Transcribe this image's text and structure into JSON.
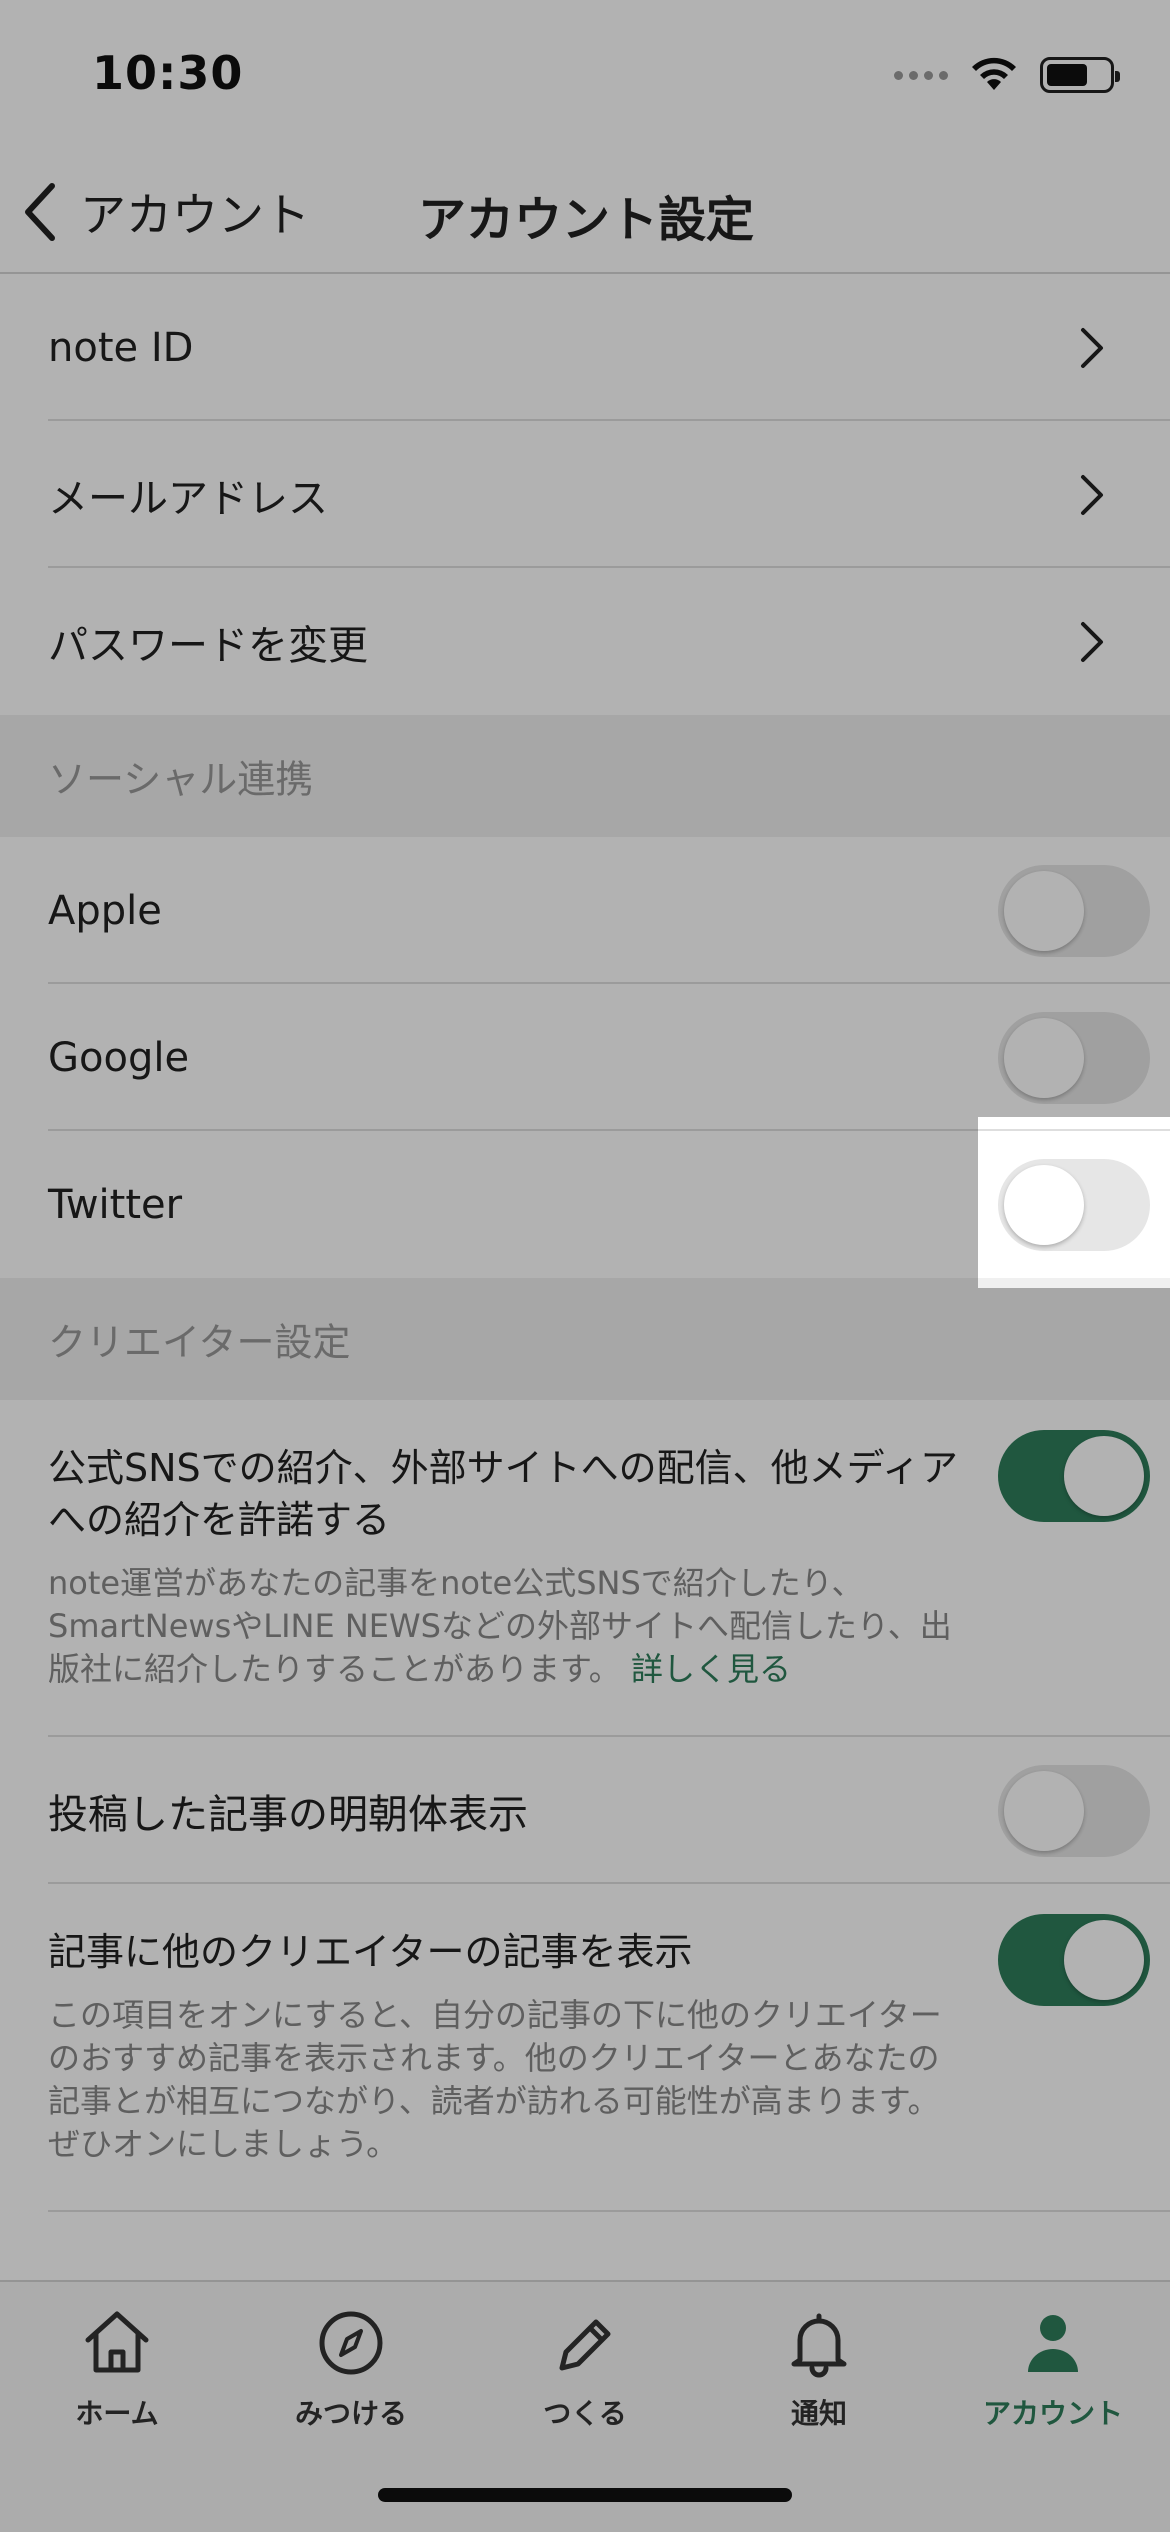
{
  "status_bar": {
    "time": "10:30"
  },
  "nav": {
    "back_label": "アカウント",
    "title": "アカウント設定"
  },
  "account_rows": [
    {
      "label": "note ID"
    },
    {
      "label": "メールアドレス"
    },
    {
      "label": "パスワードを変更"
    }
  ],
  "social_section": {
    "title": "ソーシャル連携",
    "items": [
      {
        "label": "Apple",
        "enabled": false
      },
      {
        "label": "Google",
        "enabled": false
      },
      {
        "label": "Twitter",
        "enabled": false
      }
    ]
  },
  "creator_section": {
    "title": "クリエイター設定",
    "sns_permission": {
      "title": "公式SNSでの紹介、外部サイトへの配信、他メディアへの紹介を許諾する",
      "description": "note運営があなたの記事をnote公式SNSで紹介したり、SmartNewsやLINE NEWSなどの外部サイトへ配信したり、出版社に紹介したりすることがあります。",
      "link": "詳しく見る",
      "enabled": true
    },
    "mincho": {
      "title": "投稿した記事の明朝体表示",
      "enabled": false
    },
    "related": {
      "title": "記事に他のクリエイターの記事を表示",
      "description": "この項目をオンにすると、自分の記事の下に他のクリエイターのおすすめ記事を表示されます。他のクリエイターとあなたの記事とが相互につながり、読者が訪れる可能性が高まります。ぜひオンにしましょう。",
      "enabled": true
    }
  },
  "tab_bar": {
    "tabs": [
      {
        "label": "ホーム",
        "icon": "home-icon"
      },
      {
        "label": "みつける",
        "icon": "compass-icon"
      },
      {
        "label": "つくる",
        "icon": "pencil-icon"
      },
      {
        "label": "通知",
        "icon": "bell-icon"
      },
      {
        "label": "アカウント",
        "icon": "person-icon",
        "active": true
      }
    ]
  },
  "colors": {
    "accent": "#2e7d5b",
    "overlay": "rgba(0,0,0,0.3)"
  }
}
